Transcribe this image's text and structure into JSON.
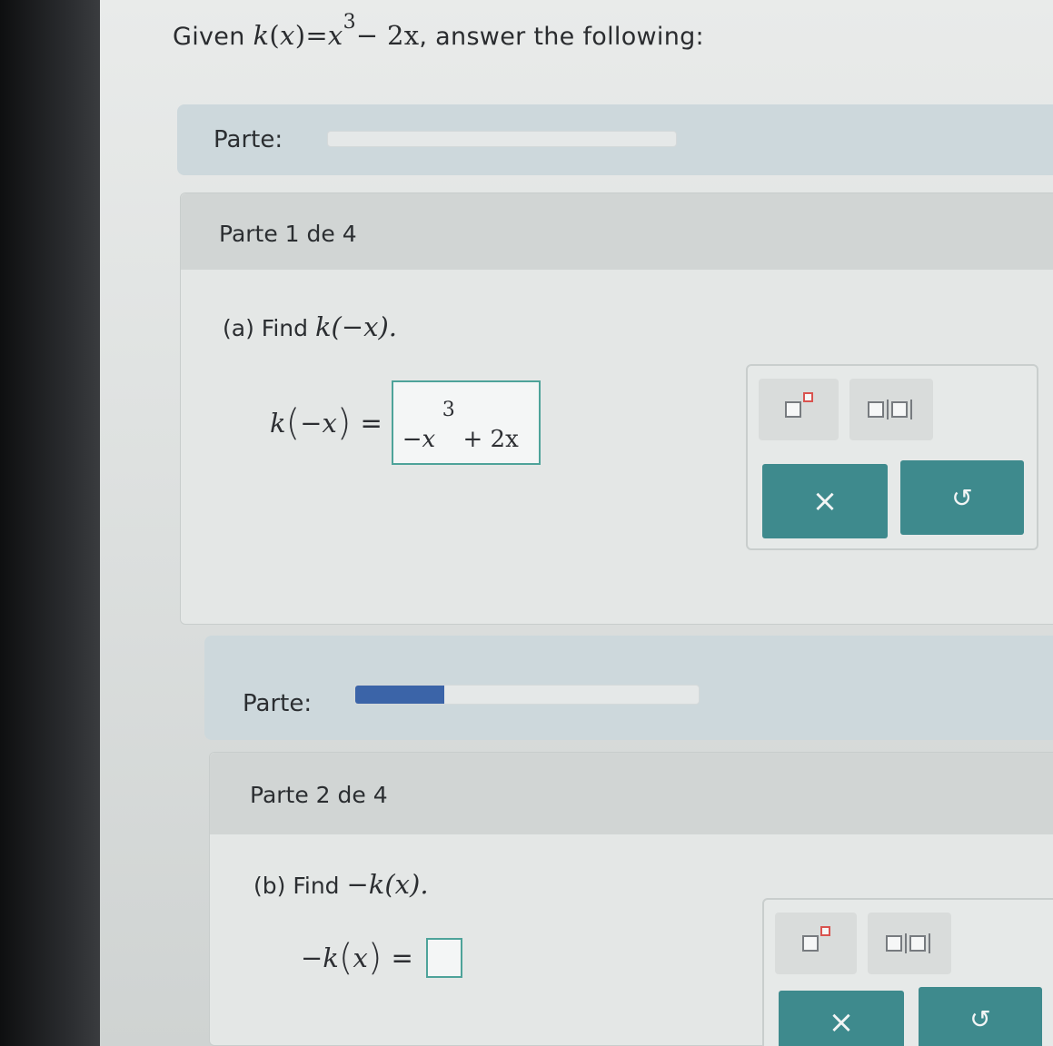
{
  "question": {
    "prefix": "Given",
    "func_lhs": "k",
    "func_var": "x",
    "func_rhs_base": "x",
    "func_exponent": "3",
    "func_rhs_tail": "− 2x",
    "suffix": ", answer the following:"
  },
  "parte_label_1": "Parte:",
  "parte_label_2": "Parte:",
  "progress_1": 0,
  "progress_2": 0.26,
  "part1": {
    "title": "Parte 1 de 4",
    "prompt_prefix": "(a) Find",
    "prompt_expr": "k(−x).",
    "eq_lhs_fn": "k",
    "eq_lhs_arg": "−x",
    "eq_sign": "=",
    "answer_base": "−x",
    "answer_exponent": "3",
    "answer_tail": "+ 2x"
  },
  "part2": {
    "title": "Parte 2 de 4",
    "prompt_prefix": "(b) Find",
    "prompt_expr": "−k(x).",
    "eq_lhs_fn": "−k",
    "eq_lhs_arg": "x",
    "eq_sign": "="
  },
  "toolbox": {
    "clear_symbol": "×",
    "undo_symbol": "↺"
  },
  "colors": {
    "accent_teal": "#3e8a8d",
    "progress_blue": "#3b64a8",
    "answer_border": "#4ea39a"
  }
}
